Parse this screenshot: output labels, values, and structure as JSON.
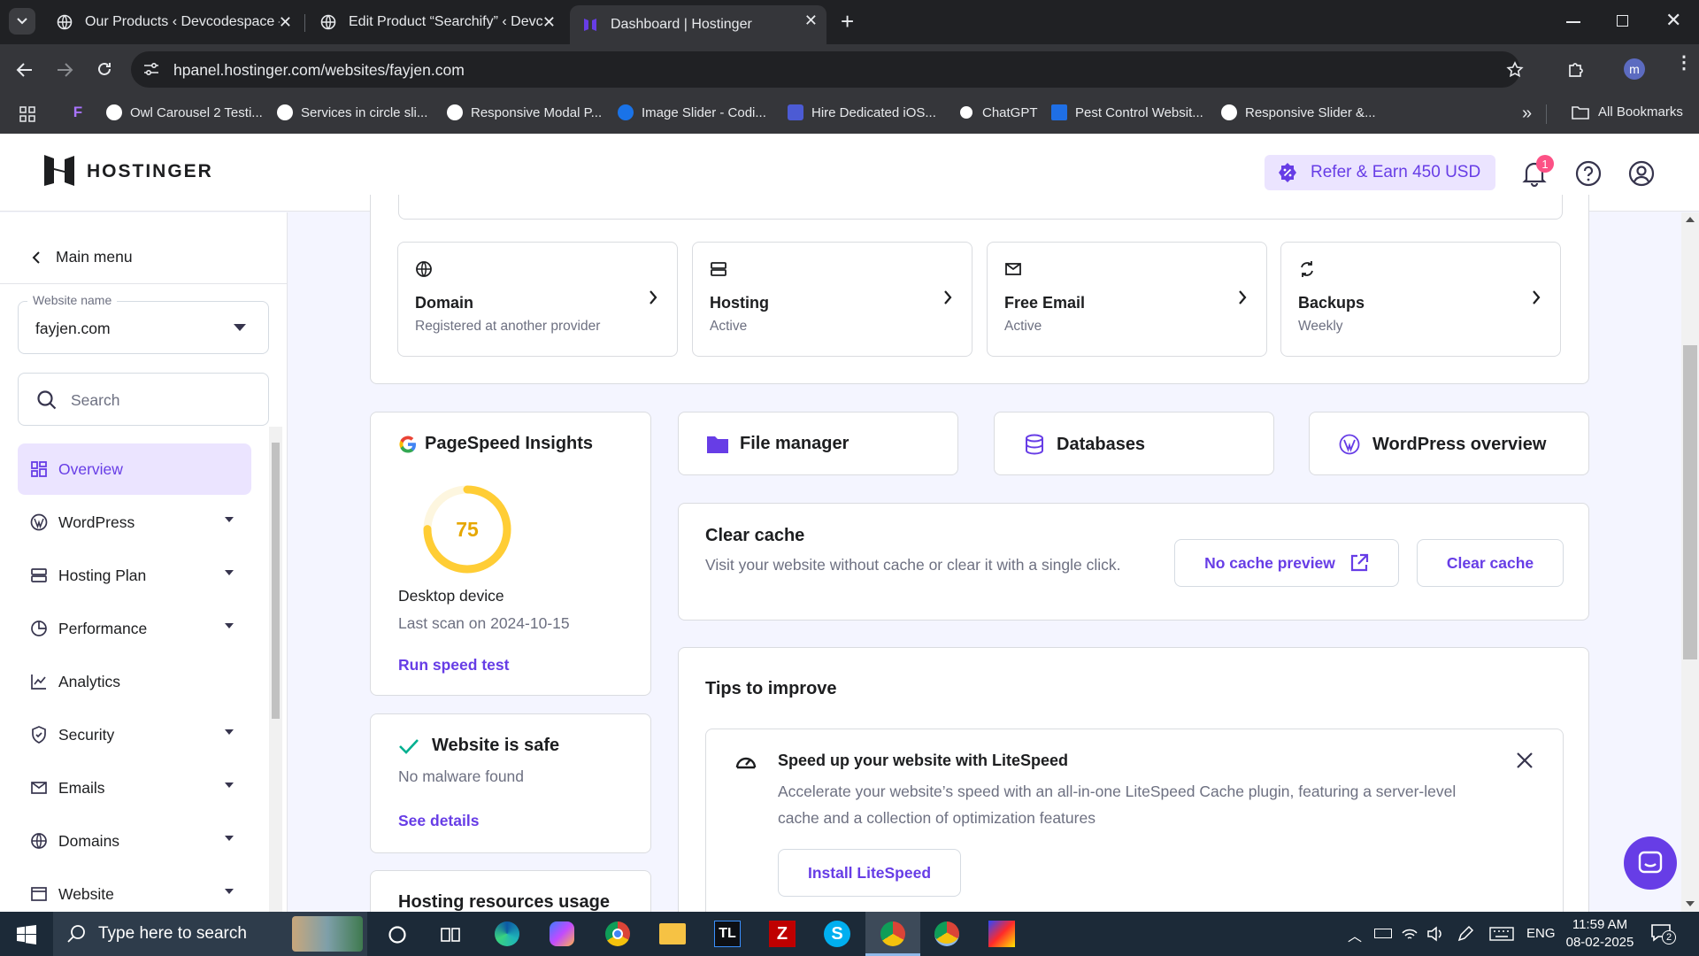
{
  "browser": {
    "tabs": [
      {
        "title": "Our Products ‹ Devcodespace —"
      },
      {
        "title": "Edit Product “Searchify” ‹ Devco"
      },
      {
        "title": "Dashboard | Hostinger"
      }
    ],
    "url": "hpanel.hostinger.com/websites/fayjen.com",
    "profile_initial": "m",
    "bookmarks": [
      {
        "label": "Owl Carousel 2 Testi..."
      },
      {
        "label": "Services in circle sli..."
      },
      {
        "label": "Responsive Modal P..."
      },
      {
        "label": "Image Slider - Codi..."
      },
      {
        "label": "Hire Dedicated iOS..."
      },
      {
        "label": "ChatGPT"
      },
      {
        "label": "Pest Control Websit..."
      },
      {
        "label": "Responsive Slider &..."
      }
    ],
    "all_bookmarks": "All Bookmarks"
  },
  "header": {
    "logo_text": "HOSTINGER",
    "refer_label": "Refer & Earn 450 USD",
    "notification_count": "1"
  },
  "sidebar": {
    "main_menu": "Main menu",
    "website_name_label": "Website name",
    "website_name_value": "fayjen.com",
    "search_placeholder": "Search",
    "items": [
      {
        "label": "Overview"
      },
      {
        "label": "WordPress"
      },
      {
        "label": "Hosting Plan"
      },
      {
        "label": "Performance"
      },
      {
        "label": "Analytics"
      },
      {
        "label": "Security"
      },
      {
        "label": "Emails"
      },
      {
        "label": "Domains"
      },
      {
        "label": "Website"
      }
    ]
  },
  "quick_cards": [
    {
      "title": "Domain",
      "subtitle": "Registered at another provider"
    },
    {
      "title": "Hosting",
      "subtitle": "Active"
    },
    {
      "title": "Free Email",
      "subtitle": "Active"
    },
    {
      "title": "Backups",
      "subtitle": "Weekly"
    }
  ],
  "pagespeed": {
    "title": "PageSpeed Insights",
    "score": "75",
    "score_fraction": 0.75,
    "device": "Desktop device",
    "last_scan": "Last scan on 2024-10-15",
    "run_label": "Run speed test"
  },
  "safe": {
    "title": "Website is safe",
    "subtitle": "No malware found",
    "link": "See details"
  },
  "resources": {
    "title": "Hosting resources usage"
  },
  "tools": [
    {
      "label": "File manager"
    },
    {
      "label": "Databases"
    },
    {
      "label": "WordPress overview"
    }
  ],
  "cache": {
    "title": "Clear cache",
    "desc": "Visit your website without cache or clear it with a single click.",
    "no_cache_btn": "No cache preview",
    "clear_btn": "Clear cache"
  },
  "tips": {
    "title": "Tips to improve",
    "tip_title": "Speed up your website with LiteSpeed",
    "tip_desc": "Accelerate your website’s speed with an all-in-one LiteSpeed Cache plugin, featuring a server-level cache and a collection of optimization features",
    "tip_button": "Install LiteSpeed"
  },
  "taskbar": {
    "search_placeholder": "Type here to search",
    "lang": "ENG",
    "time": "11:59 AM",
    "date": "08-02-2025",
    "notif_count": "2"
  }
}
